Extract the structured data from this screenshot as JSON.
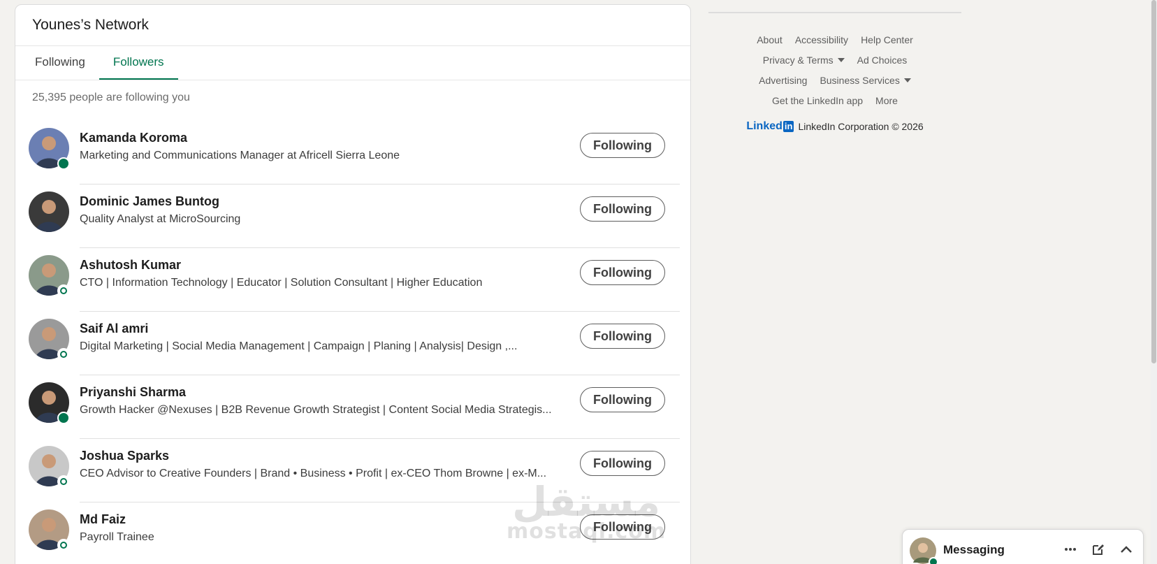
{
  "network": {
    "title": "Younes’s Network",
    "tabs": [
      {
        "label": "Following",
        "active": false
      },
      {
        "label": "Followers",
        "active": true
      }
    ],
    "count_text": "25,395 people are following you"
  },
  "people": [
    {
      "name": "Kamanda Koroma",
      "headline": "Marketing and Communications Manager at Africell Sierra Leone",
      "button": "Following",
      "presence": "solid",
      "avatar_color": "#6b7fb3"
    },
    {
      "name": "Dominic James Buntog",
      "headline": "Quality Analyst at MicroSourcing",
      "button": "Following",
      "presence": "none",
      "avatar_color": "#3a3a3a"
    },
    {
      "name": "Ashutosh Kumar",
      "headline": "CTO | Information Technology | Educator | Solution Consultant | Higher Education",
      "button": "Following",
      "presence": "ring",
      "avatar_color": "#8a9a8a"
    },
    {
      "name": "Saif Al amri",
      "headline": "Digital Marketing | Social Media Management | Campaign | Planing | Analysis| Design ,...",
      "button": "Following",
      "presence": "ring",
      "avatar_color": "#9a9a9a"
    },
    {
      "name": "Priyanshi Sharma",
      "headline": "Growth Hacker @Nexuses | B2B Revenue Growth Strategist | Content Social Media Strategis...",
      "button": "Following",
      "presence": "solid",
      "avatar_color": "#2b2b2b"
    },
    {
      "name": "Joshua Sparks",
      "headline": "CEO Advisor to Creative Founders | Brand • Business • Profit | ex-CEO Thom Browne | ex-M...",
      "button": "Following",
      "presence": "ring",
      "avatar_color": "#c8c8c8"
    },
    {
      "name": "Md Faiz",
      "headline": "Payroll Trainee",
      "button": "Following",
      "presence": "ring",
      "avatar_color": "#b39b84"
    }
  ],
  "footer": {
    "rows": [
      [
        {
          "label": "About"
        },
        {
          "label": "Accessibility"
        },
        {
          "label": "Help Center"
        }
      ],
      [
        {
          "label": "Privacy & Terms",
          "dropdown": true
        },
        {
          "label": "Ad Choices"
        }
      ],
      [
        {
          "label": "Advertising"
        },
        {
          "label": "Business Services",
          "dropdown": true
        }
      ],
      [
        {
          "label": "Get the LinkedIn app"
        },
        {
          "label": "More"
        }
      ]
    ],
    "logo_text": "Linked",
    "logo_box": "in",
    "corp_text": "LinkedIn Corporation © 2026"
  },
  "watermark": {
    "arabic": "مستقل",
    "latin": "mostaql.com"
  },
  "messaging": {
    "title": "Messaging",
    "icons": [
      "more-icon",
      "compose-icon",
      "chevron-up-icon"
    ]
  },
  "colors": {
    "accent": "#01754f",
    "presence": "#01754f",
    "linkedin_blue": "#0a66c2"
  }
}
